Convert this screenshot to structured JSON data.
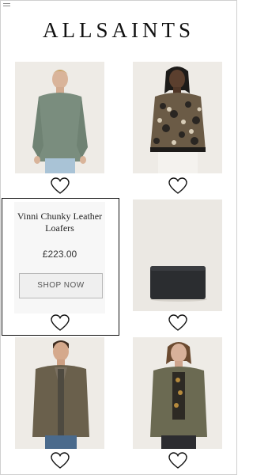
{
  "header": {
    "brand": "ALLSAINTS",
    "menu_icon": "hamburger-menu-icon"
  },
  "products": [
    {
      "image": "man-green-sweater",
      "wishlist_icon": "heart-outline-icon"
    },
    {
      "image": "man-camo-jacket",
      "wishlist_icon": "heart-outline-icon"
    },
    {
      "image": "promo-loafers",
      "wishlist_icon": "heart-outline-icon"
    },
    {
      "image": "black-leather-wallet",
      "wishlist_icon": "heart-outline-icon"
    },
    {
      "image": "man-khaki-blazer",
      "wishlist_icon": "heart-outline-icon"
    },
    {
      "image": "man-khaki-overshirt",
      "wishlist_icon": "heart-outline-icon"
    }
  ],
  "promo": {
    "title": "Vinni Chunky Leather Loafers",
    "price": "£223.00",
    "cta": "SHOP NOW"
  },
  "colors": {
    "card_bg": "#efece7",
    "border": "#111111"
  }
}
